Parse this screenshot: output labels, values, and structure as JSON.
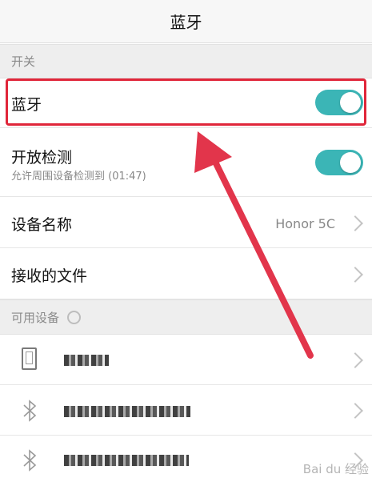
{
  "title": "蓝牙",
  "sections": {
    "switch": "开关",
    "available": "可用设备"
  },
  "bluetooth": {
    "label": "蓝牙",
    "enabled": true
  },
  "discoverable": {
    "label": "开放检测",
    "sublabel": "允许周围设备检测到 (01:47)",
    "enabled": true
  },
  "device_name": {
    "label": "设备名称",
    "value": "Honor 5C"
  },
  "received_files": {
    "label": "接收的文件"
  },
  "devices": [
    {
      "icon": "phone-icon",
      "name_obscured": true
    },
    {
      "icon": "bluetooth-icon",
      "name_obscured": true
    },
    {
      "icon": "bluetooth-icon",
      "name_obscured": true
    }
  ],
  "watermark": "Bai du 经验",
  "colors": {
    "toggle_on": "#3bb5b6",
    "highlight": "#e0263a",
    "arrow": "#e2354b"
  }
}
